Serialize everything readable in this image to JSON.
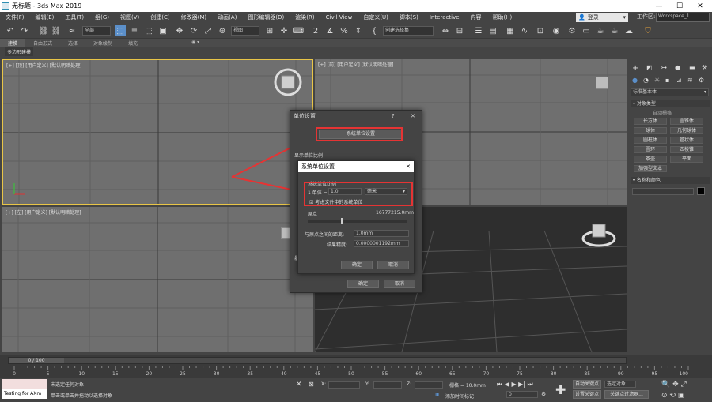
{
  "window": {
    "title": "无标题 - 3ds Max 2019",
    "minimize": "—",
    "maximize": "☐",
    "close": "✕"
  },
  "menu": [
    "文件(F)",
    "编辑(E)",
    "工具(T)",
    "组(G)",
    "视图(V)",
    "创建(C)",
    "修改器(M)",
    "动画(A)",
    "图形编辑器(D)",
    "渲染(R)",
    "Civil View",
    "自定义(U)",
    "脚本(S)",
    "Interactive",
    "内容",
    "帮助(H)"
  ],
  "login": {
    "label": "登录"
  },
  "workspace": {
    "label": "工作区:",
    "value": "Workspace_1"
  },
  "toolbar": {
    "filter_value": "全部",
    "view_value": "视图",
    "selection_set_placeholder": "创建选择集"
  },
  "ribbon": {
    "tabs": [
      "建模",
      "自由形式",
      "选择",
      "对象绘制",
      "填充"
    ],
    "subtab": "多边形建模"
  },
  "viewports": {
    "top": "[+] [顶] [用户定义] [默认明暗处理]",
    "front": "[+] [前] [用户定义] [默认明暗处理]",
    "left": "[+] [左] [用户定义] [默认明暗处理]"
  },
  "command_panel": {
    "dropdown": "标准基本体",
    "object_type_header": "▾ 对象类型",
    "auto_grid": "自动栅格",
    "objects": [
      "长方体",
      "圆锥体",
      "球体",
      "几何球体",
      "圆柱体",
      "管状体",
      "圆环",
      "四棱锥",
      "茶壶",
      "平面",
      "加强型文本"
    ],
    "name_color_header": "▾ 名称和颜色"
  },
  "units_dialog": {
    "title": "单位设置",
    "help": "?",
    "close": "✕",
    "system_units_button": "系统单位设置",
    "display_scale_label": "显示单位比例",
    "hidden_row_label": "暴",
    "ok": "确定",
    "cancel": "取消"
  },
  "system_units_dialog": {
    "title": "系统单位设置",
    "close": "✕",
    "group_label": "系统单位比例",
    "unit_prefix": "1 单位 =",
    "unit_value": "1.0",
    "unit_type": "毫米",
    "respect_checkbox": "考虑文件中的系统单位",
    "origin_label": "原点",
    "origin_value": "16777215.0mm",
    "distance_label": "与原点之间的距离:",
    "distance_value": "1.0mm",
    "precision_label": "结果精度:",
    "precision_value": "0.0000001192mm",
    "ok": "确定",
    "cancel": "取消"
  },
  "timeline": {
    "frame": "0 / 100",
    "ticks": [
      "0",
      "5",
      "10",
      "15",
      "20",
      "25",
      "30",
      "35",
      "40",
      "45",
      "50",
      "55",
      "60",
      "65",
      "70",
      "75",
      "80",
      "85",
      "90",
      "95",
      "100"
    ]
  },
  "status": {
    "script_box": "Testing for AXm",
    "line1": "未选定任何对象",
    "line2": "单击或单击并拖动以选择对象",
    "x_label": "X:",
    "y_label": "Y:",
    "z_label": "Z:",
    "grid": "栅格 = 10.0mm",
    "add_time_tag": "添加时间标记",
    "auto_key": "自动关键点",
    "set_key": "设置关键点",
    "selected_object": "选定对象",
    "key_filters": "关键点过滤器...",
    "frame_value": "0"
  },
  "colors": {
    "accent_red": "#e53434",
    "highlight_yellow": "#e8c547",
    "viewport_bg": "#6f6f6f"
  }
}
